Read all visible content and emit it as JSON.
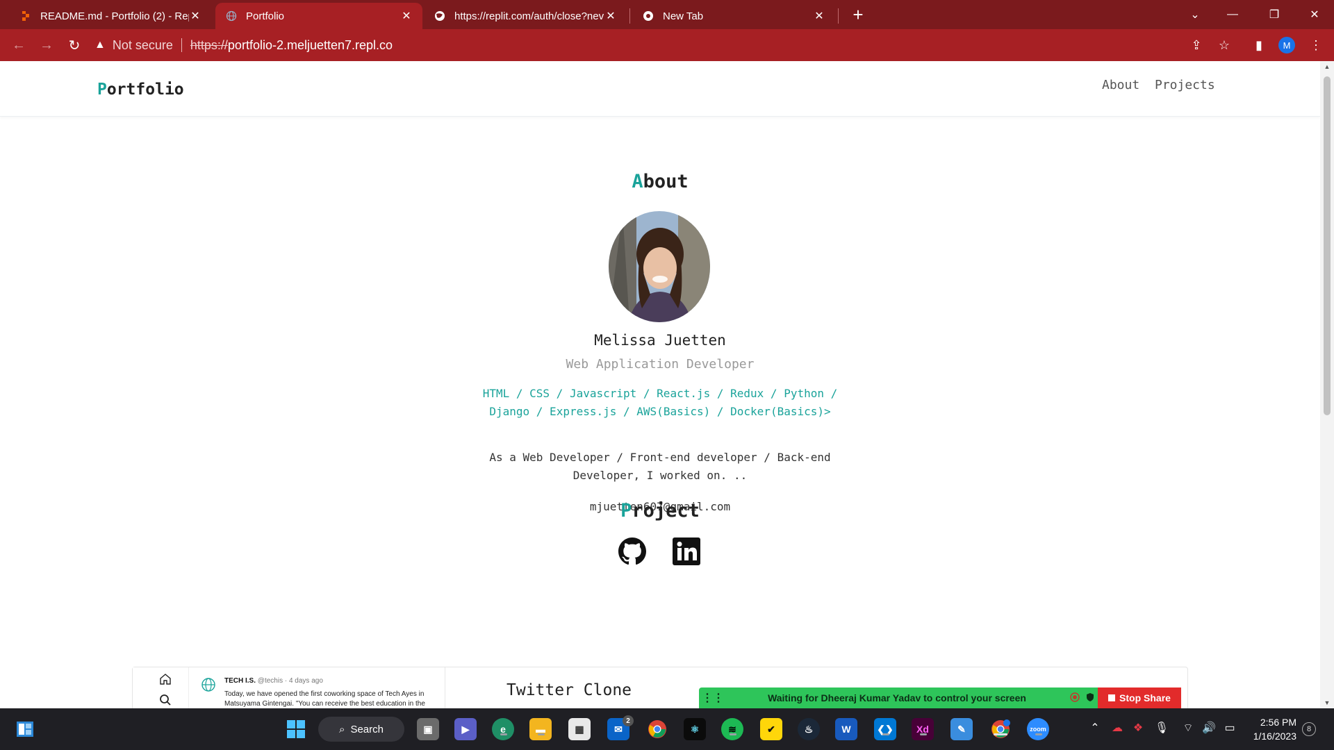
{
  "browser": {
    "tabs": [
      {
        "title": "README.md - Portfolio (2) - Repl",
        "icon": "replit-icon"
      },
      {
        "title": "Portfolio",
        "icon": "globe-icon"
      },
      {
        "title": "https://replit.com/auth/close?nev",
        "icon": "globe-icon"
      },
      {
        "title": "New Tab",
        "icon": "chrome-icon"
      }
    ],
    "new_tab_label": "+",
    "security_label": "Not secure",
    "url_scheme": "https://",
    "url_host": "portfolio-2.meljuetten7.repl.co",
    "profile_initial": "M",
    "theme_color": "#a72024"
  },
  "site": {
    "brand_first": "P",
    "brand_rest": "ortfolio",
    "nav": [
      "About",
      "Projects"
    ],
    "accent_color": "#1aa39a",
    "about": {
      "title_first": "A",
      "title_rest": "bout",
      "name": "Melissa Juetten",
      "role": "Web Application Developer",
      "skills": "HTML / CSS / Javascript / React.js / Redux / Python / Django / Express.js / AWS(Basics) / Docker(Basics)>",
      "bio": "As a Web Developer / Front-end developer / Back-end Developer, I worked on. ..",
      "email": "mjuetten607@gmail.com",
      "social": [
        "github-icon",
        "linkedin-icon"
      ]
    },
    "project": {
      "title_first": "P",
      "title_rest": "roject",
      "card_title": "Twitter Clone",
      "preview": {
        "author": "TECH I.S.",
        "meta": "@techis · 4 days ago",
        "text": "Today, we have opened the first coworking space of Tech Ayes in Matsuyama Gintengai. \"You can receive the best education in the"
      }
    }
  },
  "share": {
    "message": "Waiting for Dheeraj Kumar Yadav to control your screen",
    "stop_label": "Stop Share"
  },
  "taskbar": {
    "search_label": "Search",
    "mail_badge": "2",
    "time": "2:56 PM",
    "date": "1/16/2023",
    "notifications": "8",
    "apps": [
      "task-view-icon",
      "teams-icon",
      "edge-icon",
      "file-explorer-icon",
      "store-icon",
      "mail-icon",
      "chrome-icon",
      "atom-icon",
      "spotify-icon",
      "norton-icon",
      "steam-icon",
      "word-icon",
      "vscode-icon",
      "xd-icon",
      "paint-icon",
      "chrome-profile-icon",
      "zoom-icon"
    ]
  }
}
